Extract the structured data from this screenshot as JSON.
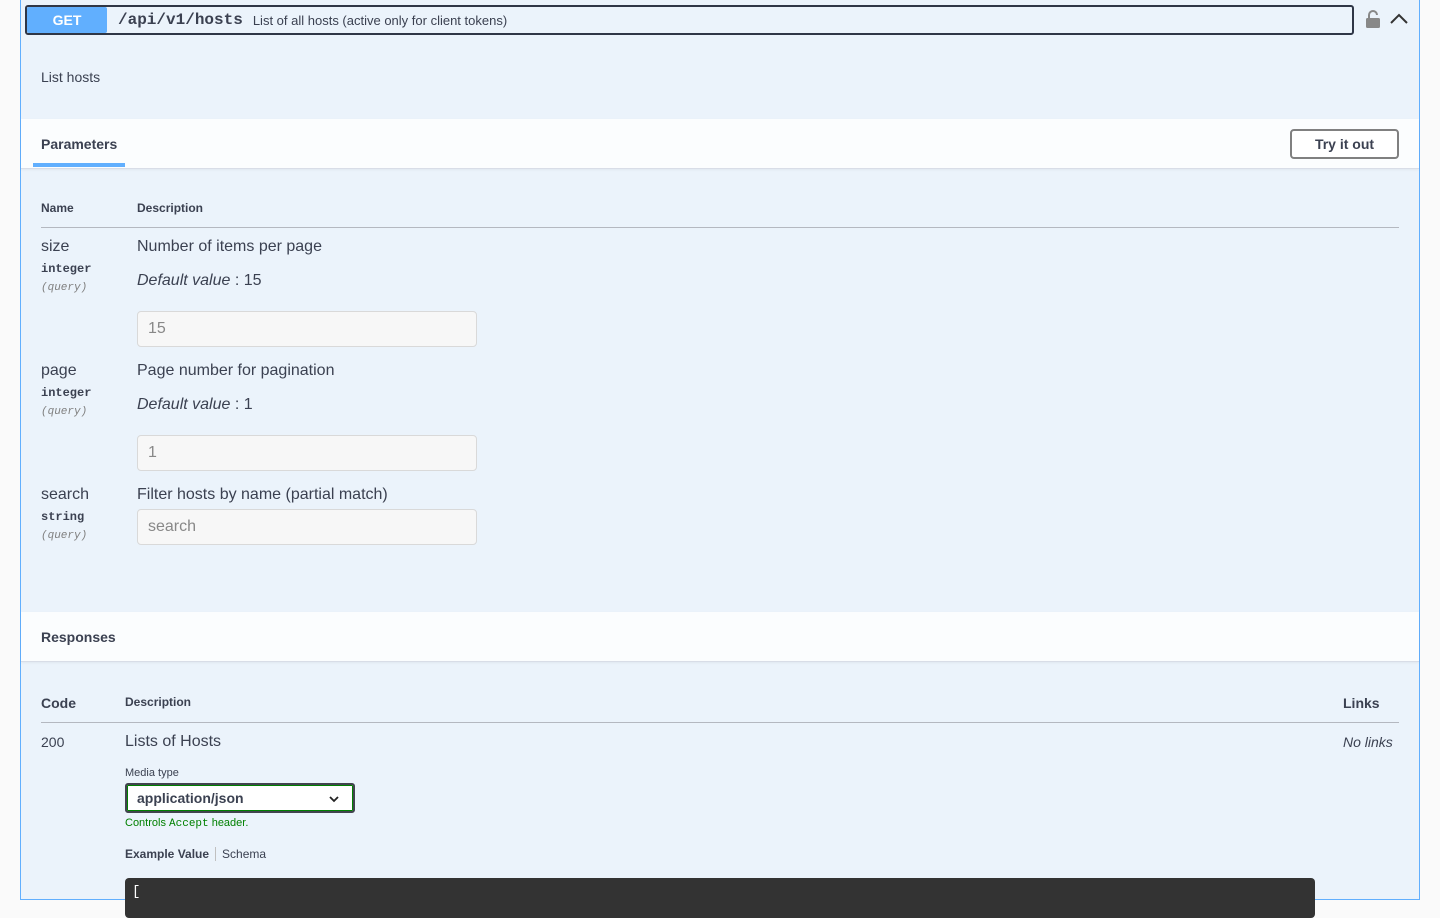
{
  "operation": {
    "method": "GET",
    "path": "/api/v1/hosts",
    "summary": "List of all hosts (active only for client tokens)",
    "description": "List hosts"
  },
  "params_section": {
    "tab_label": "Parameters",
    "try_button": "Try it out",
    "col_name": "Name",
    "col_description": "Description",
    "items": [
      {
        "name": "size",
        "type": "integer",
        "in": "(query)",
        "description": "Number of items per page",
        "default_label": "Default value",
        "default_sep": " : 15",
        "input_value": "15"
      },
      {
        "name": "page",
        "type": "integer",
        "in": "(query)",
        "description": "Page number for pagination",
        "default_label": "Default value",
        "default_sep": " : 1",
        "input_value": "1"
      },
      {
        "name": "search",
        "type": "string",
        "in": "(query)",
        "description": "Filter hosts by name (partial match)",
        "input_placeholder": "search"
      }
    ]
  },
  "responses_section": {
    "title": "Responses",
    "col_code": "Code",
    "col_description": "Description",
    "col_links": "Links",
    "row": {
      "code": "200",
      "description": "Lists of Hosts",
      "links": "No links",
      "media_label": "Media type",
      "media_value": "application/json",
      "accept_pre": "Controls ",
      "accept_code": "Accept",
      "accept_post": " header.",
      "tab_example": "Example Value",
      "tab_schema": "Schema",
      "code_start": "["
    }
  },
  "colors": {
    "get_accent": "#61affe",
    "border_dark": "#2f3646",
    "green": "#008000"
  },
  "icons": [
    "lock-icon",
    "chevron-up-icon",
    "chevron-down-icon"
  ]
}
